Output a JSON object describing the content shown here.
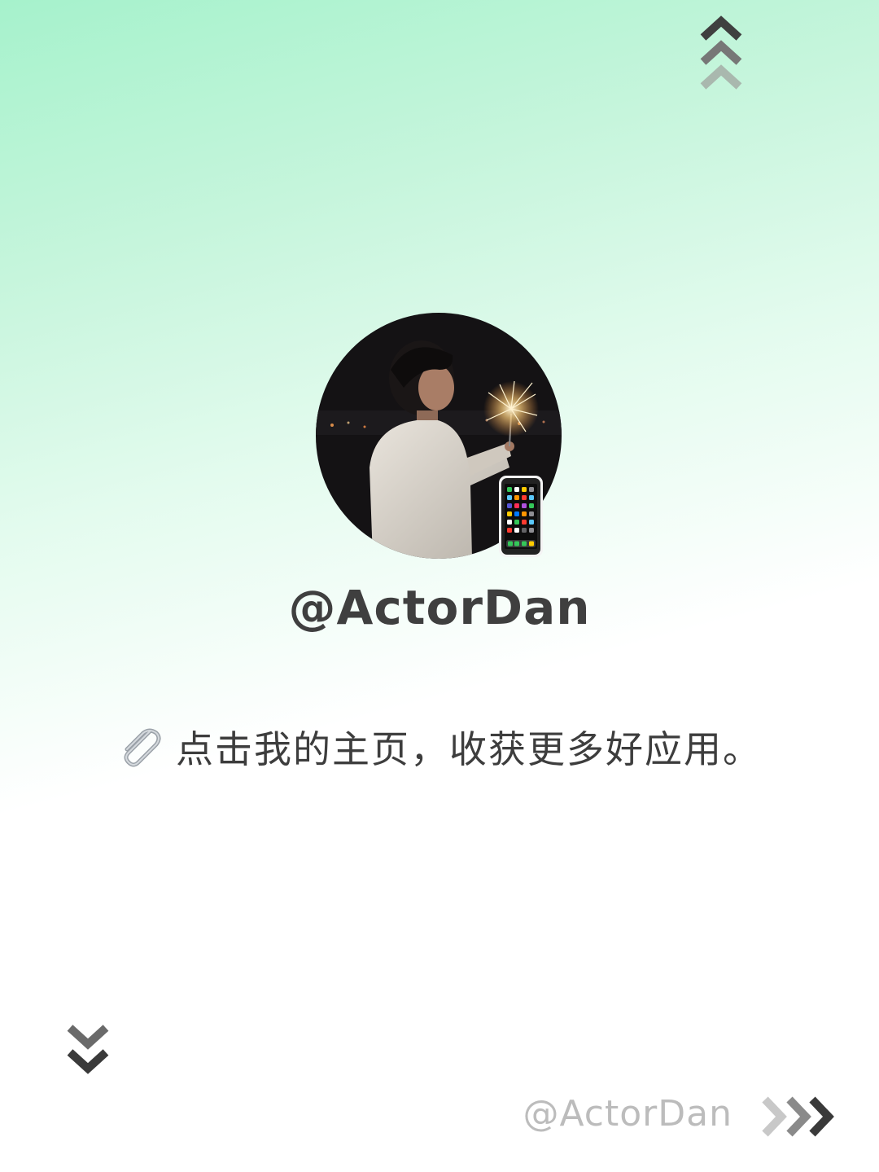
{
  "profile": {
    "handle": "@ActorDan",
    "avatar_alt": "",
    "badge_emoji": "mobile-phone-icon"
  },
  "tagline": {
    "icon": "paperclip-icon",
    "text": "点击我的主页，收获更多好应用。"
  },
  "footer": {
    "handle": "@ActorDan"
  },
  "icons": {
    "top": "chevrons-up-icon",
    "left_bottom": "chevrons-down-icon",
    "right_bottom": "chevrons-right-icon"
  },
  "colors": {
    "bg_top": "#a6f2cc",
    "bg_bottom": "#ffffff",
    "text_dark": "#3f3f3f",
    "text_muted": "#bcbcbc"
  }
}
